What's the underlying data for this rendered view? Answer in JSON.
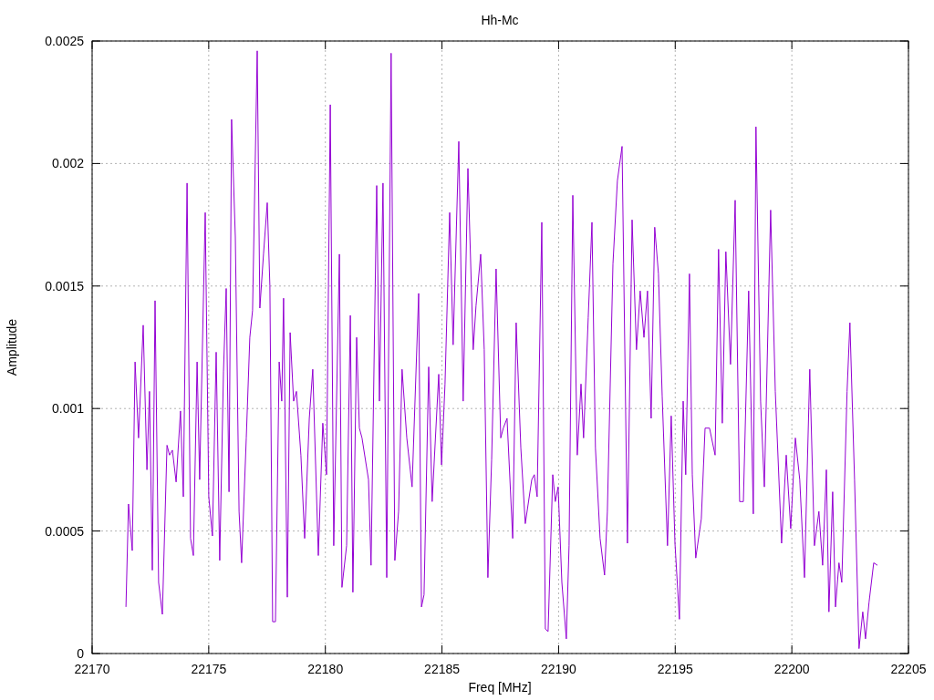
{
  "chart_data": {
    "type": "line",
    "title": "Hh-Mc",
    "xlabel": "Freq [MHz]",
    "ylabel": "Amplitude",
    "grid": true,
    "xlim": [
      22170,
      22205
    ],
    "ylim": [
      0,
      0.0025
    ],
    "xticks": [
      22170,
      22175,
      22180,
      22185,
      22190,
      22195,
      22200,
      22205
    ],
    "yticks": [
      {
        "value": 0,
        "label": "0"
      },
      {
        "value": 0.0005,
        "label": "0.0005"
      },
      {
        "value": 0.001,
        "label": "0.001"
      },
      {
        "value": 0.0015,
        "label": "0.0015"
      },
      {
        "value": 0.002,
        "label": "0.002"
      },
      {
        "value": 0.0025,
        "label": "0.0025"
      }
    ],
    "x": [
      22171.45,
      22171.56,
      22171.72,
      22171.84,
      22171.99,
      22172.19,
      22172.35,
      22172.46,
      22172.58,
      22172.7,
      22172.85,
      22173.01,
      22173.21,
      22173.32,
      22173.44,
      22173.6,
      22173.79,
      22173.91,
      22174.07,
      22174.22,
      22174.34,
      22174.5,
      22174.61,
      22174.85,
      22175.0,
      22175.16,
      22175.32,
      22175.47,
      22175.63,
      22175.75,
      22175.87,
      22175.98,
      22176.14,
      22176.3,
      22176.41,
      22176.61,
      22176.76,
      22176.88,
      22177.08,
      22177.19,
      22177.35,
      22177.51,
      22177.62,
      22177.74,
      22177.86,
      22178.02,
      22178.13,
      22178.21,
      22178.37,
      22178.49,
      22178.64,
      22178.76,
      22178.95,
      22179.11,
      22179.31,
      22179.46,
      22179.7,
      22179.89,
      22180.05,
      22180.21,
      22180.36,
      22180.6,
      22180.71,
      22180.91,
      22181.07,
      22181.18,
      22181.34,
      22181.46,
      22181.57,
      22181.85,
      22181.96,
      22182.2,
      22182.32,
      22182.47,
      22182.63,
      22182.82,
      22182.98,
      22183.14,
      22183.29,
      22183.49,
      22183.72,
      22184.0,
      22184.12,
      22184.23,
      22184.43,
      22184.58,
      22184.86,
      22184.98,
      22185.13,
      22185.33,
      22185.48,
      22185.72,
      22185.91,
      22186.11,
      22186.34,
      22186.46,
      22186.66,
      22186.81,
      22186.97,
      22187.13,
      22187.32,
      22187.52,
      22187.63,
      22187.79,
      22188.03,
      22188.18,
      22188.38,
      22188.57,
      22188.85,
      22188.96,
      22189.08,
      22189.28,
      22189.43,
      22189.55,
      22189.75,
      22189.86,
      22189.98,
      22190.14,
      22190.33,
      22190.45,
      22190.61,
      22190.8,
      22190.96,
      22191.07,
      22191.27,
      22191.43,
      22191.58,
      22191.78,
      22191.97,
      22192.09,
      22192.33,
      22192.52,
      22192.72,
      22192.95,
      22193.15,
      22193.34,
      22193.5,
      22193.66,
      22193.81,
      22193.97,
      22194.12,
      22194.28,
      22194.44,
      22194.67,
      22194.83,
      22194.99,
      22195.18,
      22195.34,
      22195.45,
      22195.61,
      22195.73,
      22195.88,
      22196.12,
      22196.28,
      22196.47,
      22196.71,
      22196.86,
      22197.02,
      22197.17,
      22197.37,
      22197.57,
      22197.76,
      22197.92,
      22198.15,
      22198.35,
      22198.46,
      22198.66,
      22198.82,
      22199.09,
      22199.29,
      22199.56,
      22199.76,
      22199.95,
      22200.15,
      22200.34,
      22200.54,
      22200.77,
      22200.97,
      22201.16,
      22201.32,
      22201.48,
      22201.59,
      22201.75,
      22201.87,
      22202.02,
      22202.14,
      22202.37,
      22202.49,
      22202.69,
      22202.88,
      22203.04,
      22203.16,
      22203.31,
      22203.51,
      22203.67
    ],
    "series": [
      {
        "color": "#9400d3",
        "values": [
          0.00019,
          0.00061,
          0.00042,
          0.00119,
          0.00088,
          0.00134,
          0.00075,
          0.00107,
          0.00034,
          0.00144,
          0.00029,
          0.00016,
          0.00085,
          0.00081,
          0.00083,
          0.0007,
          0.00099,
          0.00064,
          0.00192,
          0.00047,
          0.0004,
          0.00119,
          0.00071,
          0.0018,
          0.00064,
          0.00048,
          0.00123,
          0.00038,
          0.00115,
          0.00149,
          0.00066,
          0.00218,
          0.0017,
          0.00058,
          0.00037,
          0.00088,
          0.00129,
          0.0014,
          0.00246,
          0.00141,
          0.00163,
          0.00184,
          0.0015,
          0.00013,
          0.00013,
          0.00119,
          0.00103,
          0.00145,
          0.00023,
          0.00131,
          0.00103,
          0.00107,
          0.00081,
          0.00047,
          0.00096,
          0.00116,
          0.0004,
          0.00094,
          0.00073,
          0.00224,
          0.00044,
          0.00163,
          0.00027,
          0.00044,
          0.00138,
          0.00025,
          0.00129,
          0.00092,
          0.00088,
          0.00071,
          0.00036,
          0.00191,
          0.00103,
          0.00192,
          0.00031,
          0.00245,
          0.00038,
          0.00058,
          0.00116,
          0.00088,
          0.00068,
          0.00147,
          0.00019,
          0.00024,
          0.00117,
          0.00062,
          0.00114,
          0.00077,
          0.0011,
          0.0018,
          0.00126,
          0.00209,
          0.00103,
          0.00198,
          0.00124,
          0.00142,
          0.00163,
          0.00124,
          0.00031,
          0.00079,
          0.00157,
          0.00088,
          0.00092,
          0.00096,
          0.00047,
          0.00135,
          0.00084,
          0.00053,
          0.00071,
          0.00073,
          0.00064,
          0.00176,
          0.0001,
          9e-05,
          0.00073,
          0.00062,
          0.00068,
          0.00029,
          6e-05,
          0.00044,
          0.00187,
          0.00081,
          0.0011,
          0.00088,
          0.00137,
          0.00176,
          0.00084,
          0.00047,
          0.00032,
          0.00058,
          0.00159,
          0.00193,
          0.00207,
          0.00045,
          0.00177,
          0.00124,
          0.00148,
          0.00129,
          0.00148,
          0.00096,
          0.00174,
          0.00155,
          0.00105,
          0.00044,
          0.00097,
          0.00045,
          0.00014,
          0.00103,
          0.00073,
          0.00155,
          0.00073,
          0.00039,
          0.00055,
          0.00092,
          0.00092,
          0.00081,
          0.00165,
          0.00094,
          0.00164,
          0.00118,
          0.00185,
          0.00062,
          0.00062,
          0.00148,
          0.00057,
          0.00215,
          0.00103,
          0.00068,
          0.00181,
          0.00107,
          0.00045,
          0.00081,
          0.00051,
          0.00088,
          0.00071,
          0.00031,
          0.00116,
          0.00044,
          0.00058,
          0.00036,
          0.00075,
          0.00017,
          0.00066,
          0.00019,
          0.00037,
          0.00029,
          0.00107,
          0.00135,
          0.00071,
          2e-05,
          0.00017,
          6e-05,
          0.00021,
          0.00037,
          0.00036
        ]
      }
    ]
  }
}
